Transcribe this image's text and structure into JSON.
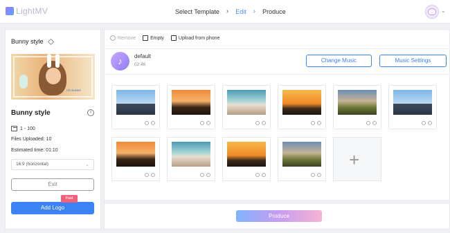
{
  "app": {
    "name": "LightMV"
  },
  "steps": [
    {
      "label": "Select Template",
      "active": false
    },
    {
      "label": "Edit",
      "active": true
    },
    {
      "label": "Produce",
      "active": false
    }
  ],
  "left_panel": {
    "title": "Bunny style",
    "style_name": "Bunny style",
    "thumbnail_caption": "ITE BUNNY",
    "range": "1 - 100",
    "files_uploaded": "Files Uploaded: 10",
    "estimated_time": "Estimated time: 01:10",
    "ratio": "16:9 (horizontal)",
    "exit_label": "Exit",
    "paid_badge": "Paid",
    "add_logo_label": "Add Logo"
  },
  "toolbar": {
    "remove": "Remove",
    "empty": "Empty",
    "upload": "Upload from phone"
  },
  "music": {
    "name": "default",
    "duration": "02:46",
    "change_label": "Change Music",
    "settings_label": "Music Settings"
  },
  "media": [
    {
      "scene": "sky-city"
    },
    {
      "scene": "sunset"
    },
    {
      "scene": "beach"
    },
    {
      "scene": "desert"
    },
    {
      "scene": "valley"
    },
    {
      "scene": "sky-city"
    },
    {
      "scene": "sunset"
    },
    {
      "scene": "beach"
    },
    {
      "scene": "desert"
    },
    {
      "scene": "valley"
    }
  ],
  "produce_label": "Produce",
  "colors": {
    "accent": "#3b82f6",
    "paid": "#f3627b",
    "active_step": "#4b8df8"
  }
}
